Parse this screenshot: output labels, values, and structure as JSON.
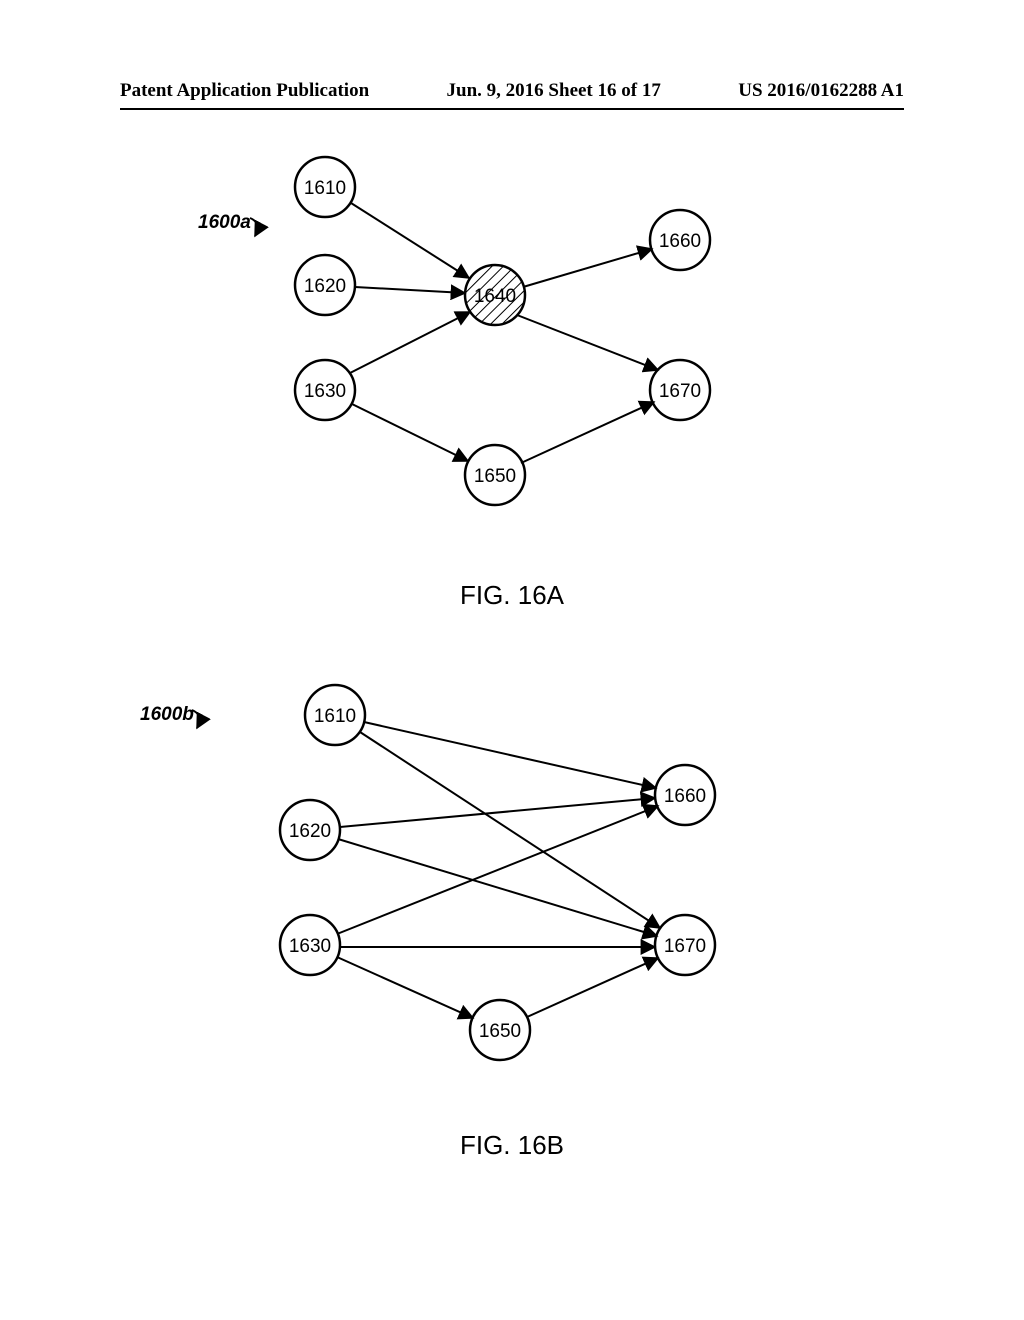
{
  "header": {
    "left": "Patent Application Publication",
    "center": "Jun. 9, 2016  Sheet 16 of 17",
    "right": "US 2016/0162288 A1"
  },
  "figA": {
    "ref": "1600a",
    "caption": "FIG. 16A",
    "nodes": {
      "n1610": "1610",
      "n1620": "1620",
      "n1630": "1630",
      "n1640": "1640",
      "n1650": "1650",
      "n1660": "1660",
      "n1670": "1670"
    }
  },
  "figB": {
    "ref": "1600b",
    "caption": "FIG. 16B",
    "nodes": {
      "n1610": "1610",
      "n1620": "1620",
      "n1630": "1630",
      "n1650": "1650",
      "n1660": "1660",
      "n1670": "1670"
    }
  }
}
